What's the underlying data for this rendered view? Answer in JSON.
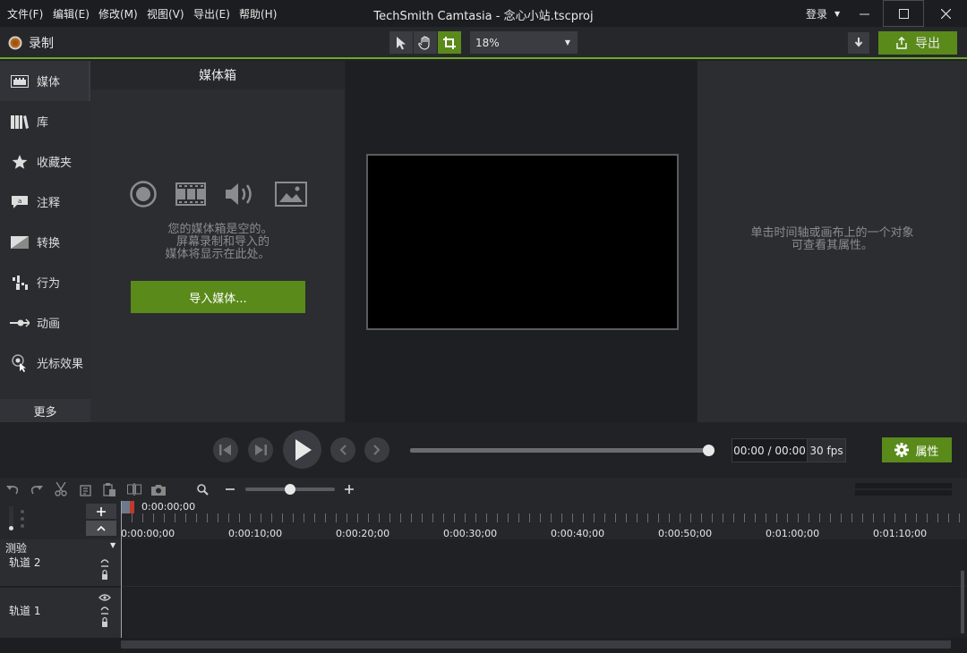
{
  "menu": [
    "文件(F)",
    "编辑(E)",
    "修改(M)",
    "视图(V)",
    "导出(E)",
    "帮助(H)"
  ],
  "title": "TechSmith Camtasia - 念心小站.tscproj",
  "login": "登录",
  "record_label": "录制",
  "zoom_value": "18%",
  "export_label": "导出",
  "sidebar": {
    "items": [
      {
        "label": "媒体",
        "icon": "film-icon"
      },
      {
        "label": "库",
        "icon": "library-icon"
      },
      {
        "label": "收藏夹",
        "icon": "star-icon"
      },
      {
        "label": "注释",
        "icon": "annotation-icon"
      },
      {
        "label": "转换",
        "icon": "transition-icon"
      },
      {
        "label": "行为",
        "icon": "behavior-icon"
      },
      {
        "label": "动画",
        "icon": "animation-icon"
      },
      {
        "label": "光标效果",
        "icon": "cursor-effect-icon"
      }
    ],
    "more_label": "更多"
  },
  "bin": {
    "header": "媒体箱",
    "empty_line1": "您的媒体箱是空的。",
    "empty_line2": "屏幕录制和导入的",
    "empty_line3": "媒体将显示在此处。",
    "import_label": "导入媒体..."
  },
  "props_hint_line1": "单击时间轴或画布上的一个对象",
  "props_hint_line2": "可查看其属性。",
  "transport": {
    "time": "00:00 / 00:00",
    "fps": "30 fps",
    "properties_label": "属性",
    "progress": 1.0
  },
  "timeline": {
    "playhead_time": "0:00:00;00",
    "ticks": [
      "0:00:00;00",
      "0:00:10;00",
      "0:00:20;00",
      "0:00:30;00",
      "0:00:40;00",
      "0:00:50;00",
      "0:01:00;00",
      "0:01:10;00"
    ],
    "group_label": "测验",
    "tracks": [
      "轨道 2",
      "轨道 1"
    ],
    "zoom_level": 0.5
  },
  "colors": {
    "accent": "#5a8a1a",
    "accent_border": "#6fa82a",
    "background": "#202226"
  }
}
